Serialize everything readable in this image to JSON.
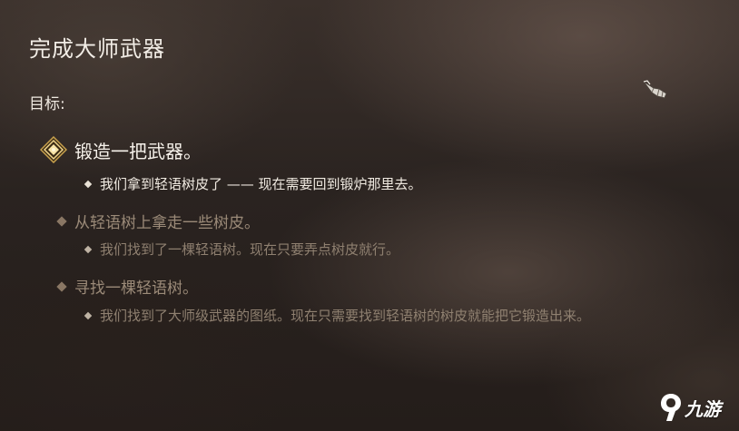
{
  "quest": {
    "title": "完成大师武器",
    "objectives_label": "目标:",
    "objectives": [
      {
        "status": "active",
        "icon": "active-objective-icon",
        "text": "锻造一把武器。",
        "note": "我们拿到轻语树皮了 —— 现在需要回到锻炉那里去。"
      },
      {
        "status": "completed",
        "icon": "diamond-bullet-icon",
        "text": "从轻语树上拿走一些树皮。",
        "note": "我们找到了一棵轻语树。现在只要弄点树皮就行。"
      },
      {
        "status": "completed",
        "icon": "diamond-bullet-icon",
        "text": "寻找一棵轻语树。",
        "note": "我们找到了大师级武器的图纸。现在只需要找到轻语树的树皮就能把它锻造出来。"
      }
    ]
  },
  "cursor": {
    "icon": "gauntlet-cursor-icon"
  },
  "watermark": {
    "logo": "jiuyou-logo-icon",
    "text": "九游"
  },
  "colors": {
    "active_text": "#f6f1ea",
    "completed_text": "#9b8a78",
    "gold_accent": "#e8c76a"
  }
}
